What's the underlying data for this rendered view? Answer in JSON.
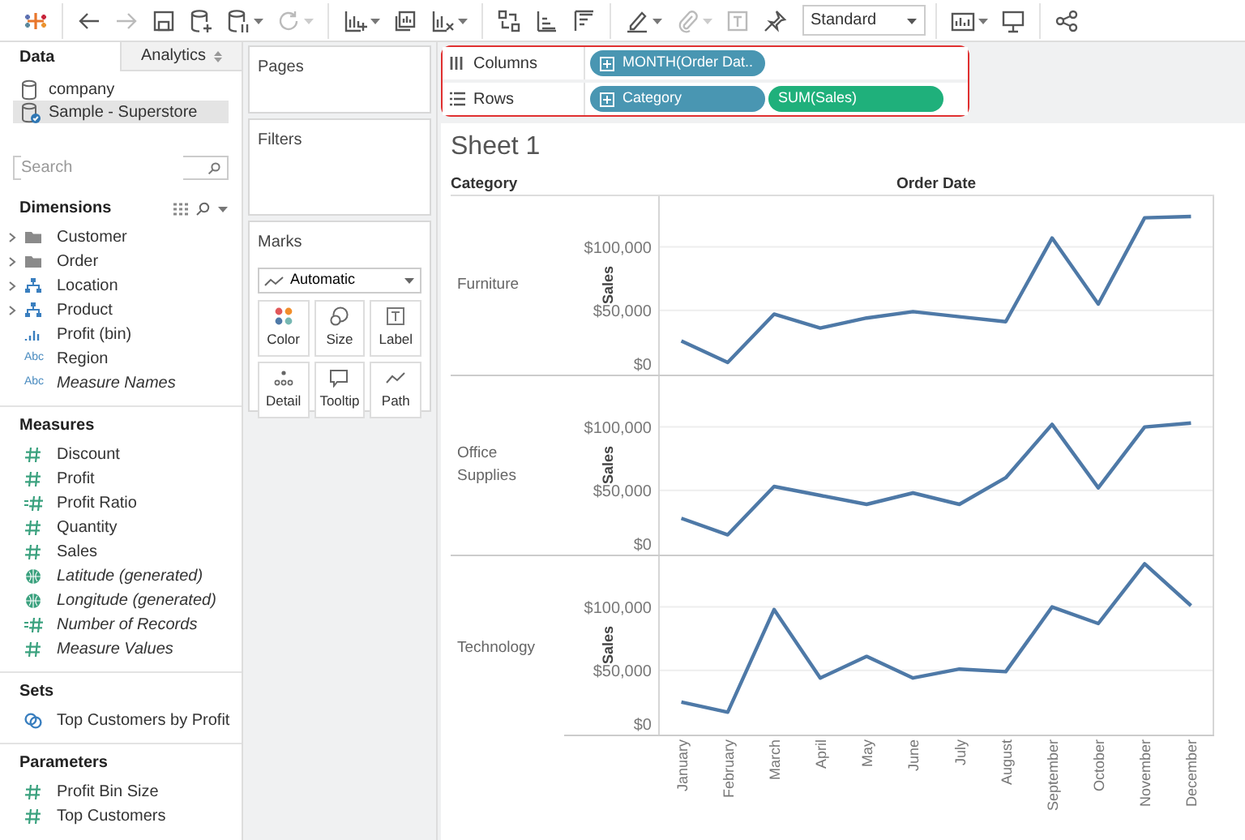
{
  "toolbar": {
    "groups": [
      [
        {
          "kind": "logo"
        }
      ],
      [
        {
          "kind": "back",
          "disabled": false,
          "menu": false
        },
        {
          "kind": "forward",
          "disabled": true,
          "menu": false
        },
        {
          "kind": "save",
          "disabled": false,
          "menu": false
        },
        {
          "kind": "new-datasource",
          "disabled": false,
          "menu": false
        },
        {
          "kind": "pause",
          "disabled": false,
          "menu": true
        },
        {
          "kind": "refresh",
          "disabled": true,
          "menu": true
        }
      ],
      [
        {
          "kind": "new-sheet",
          "disabled": false,
          "menu": true
        },
        {
          "kind": "duplicate",
          "disabled": false,
          "menu": false
        },
        {
          "kind": "clear",
          "disabled": false,
          "menu": true
        }
      ],
      [
        {
          "kind": "swap",
          "disabled": false,
          "menu": false
        },
        {
          "kind": "sort-asc",
          "disabled": false,
          "menu": false
        },
        {
          "kind": "sort-desc",
          "disabled": false,
          "menu": false
        }
      ],
      [
        {
          "kind": "highlight",
          "disabled": false,
          "menu": true
        },
        {
          "kind": "group",
          "disabled": true,
          "menu": true
        },
        {
          "kind": "label",
          "disabled": true,
          "menu": false
        },
        {
          "kind": "pin",
          "disabled": false,
          "menu": false
        },
        {
          "kind": "select",
          "value": "Standard",
          "disabled": false,
          "menu": true
        }
      ],
      [
        {
          "kind": "show-me",
          "disabled": false,
          "menu": true
        },
        {
          "kind": "presentation",
          "disabled": false,
          "menu": false
        }
      ],
      [
        {
          "kind": "share",
          "disabled": false,
          "menu": false
        }
      ]
    ]
  },
  "data_pane": {
    "tabs": [
      {
        "label": "Data",
        "selected": true
      },
      {
        "label": "Analytics",
        "selected": false
      }
    ],
    "sources": [
      {
        "name": "company",
        "selected": false
      },
      {
        "name": "Sample - Superstore",
        "selected": true
      }
    ],
    "search": {
      "placeholder": "Search"
    },
    "sections": [
      {
        "title": "Dimensions",
        "has_tools": true,
        "fields": [
          {
            "name": "Customer",
            "kind": "folder",
            "italic": false
          },
          {
            "name": "Order",
            "kind": "folder",
            "italic": false
          },
          {
            "name": "Location",
            "kind": "hierarchy",
            "italic": false
          },
          {
            "name": "Product",
            "kind": "hierarchy",
            "italic": false
          },
          {
            "name": "Profit (bin)",
            "kind": "bin",
            "italic": false
          },
          {
            "name": "Region",
            "kind": "string",
            "icon_text": "Abc",
            "italic": false
          },
          {
            "name": "Measure Names",
            "kind": "string",
            "icon_text": "Abc",
            "italic": true
          }
        ]
      },
      {
        "title": "Measures",
        "has_tools": false,
        "fields": [
          {
            "name": "Discount",
            "kind": "number",
            "italic": false
          },
          {
            "name": "Profit",
            "kind": "number",
            "italic": false
          },
          {
            "name": "Profit Ratio",
            "kind": "calc",
            "italic": false
          },
          {
            "name": "Quantity",
            "kind": "number",
            "italic": false
          },
          {
            "name": "Sales",
            "kind": "number",
            "italic": false
          },
          {
            "name": "Latitude (generated)",
            "kind": "geo",
            "italic": true
          },
          {
            "name": "Longitude (generated)",
            "kind": "geo",
            "italic": true
          },
          {
            "name": "Number of Records",
            "kind": "calc",
            "italic": true
          },
          {
            "name": "Measure Values",
            "kind": "number",
            "italic": true
          }
        ]
      },
      {
        "title": "Sets",
        "has_tools": false,
        "fields": [
          {
            "name": "Top Customers by Profit",
            "kind": "set",
            "italic": false
          }
        ]
      },
      {
        "title": "Parameters",
        "has_tools": false,
        "fields": [
          {
            "name": "Profit Bin Size",
            "kind": "number",
            "italic": false
          },
          {
            "name": "Top Customers",
            "kind": "number",
            "italic": false
          }
        ]
      }
    ]
  },
  "cards": {
    "pages": {
      "title": "Pages"
    },
    "filters": {
      "title": "Filters"
    },
    "marks": {
      "title": "Marks",
      "mark_type": "Automatic",
      "buttons": [
        {
          "kind": "color",
          "label": "Color"
        },
        {
          "kind": "size",
          "label": "Size"
        },
        {
          "kind": "label",
          "label": "Label"
        },
        {
          "kind": "detail",
          "label": "Detail"
        },
        {
          "kind": "tooltip",
          "label": "Tooltip"
        },
        {
          "kind": "path",
          "label": "Path"
        }
      ]
    }
  },
  "shelves": [
    {
      "kind": "columns",
      "label": "Columns",
      "pills": [
        {
          "text": "MONTH(Order Dat..",
          "kind": "discrete"
        }
      ]
    },
    {
      "kind": "rows",
      "label": "Rows",
      "pills": [
        {
          "text": "Category",
          "kind": "discrete"
        },
        {
          "text": "SUM(Sales)",
          "kind": "continuous"
        }
      ]
    }
  ],
  "sheet": {
    "title": "Sheet 1",
    "row_header": "Category",
    "column_header": "Order Date",
    "panes": [
      {
        "label": "Furniture",
        "chart_data": {
          "type": "line",
          "ylabel": "Sales",
          "ylim": [
            0,
            140000
          ],
          "yticks": [
            {
              "value": 0,
              "label": "$0"
            },
            {
              "value": 50000,
              "label": "$50,000"
            },
            {
              "value": 100000,
              "label": "$100,000"
            }
          ],
          "series": [
            {
              "color": "#4e79a7",
              "values": [
                26000,
                9000,
                47000,
                36000,
                44000,
                49000,
                45000,
                41000,
                107000,
                55000,
                123000,
                124000
              ]
            }
          ]
        }
      },
      {
        "label": "Office Supplies",
        "chart_data": {
          "type": "line",
          "ylabel": "Sales",
          "ylim": [
            0,
            140000
          ],
          "yticks": [
            {
              "value": 0,
              "label": "$0"
            },
            {
              "value": 50000,
              "label": "$50,000"
            },
            {
              "value": 100000,
              "label": "$100,000"
            }
          ],
          "series": [
            {
              "color": "#4e79a7",
              "values": [
                28000,
                15000,
                53000,
                46000,
                39000,
                48000,
                39000,
                60000,
                102000,
                52000,
                100000,
                103000
              ]
            }
          ]
        }
      },
      {
        "label": "Technology",
        "chart_data": {
          "type": "line",
          "ylabel": "Sales",
          "ylim": [
            0,
            140000
          ],
          "yticks": [
            {
              "value": 0,
              "label": "$0"
            },
            {
              "value": 50000,
              "label": "$50,000"
            },
            {
              "value": 100000,
              "label": "$100,000"
            }
          ],
          "categories": [
            "January",
            "February",
            "March",
            "April",
            "May",
            "June",
            "July",
            "August",
            "September",
            "October",
            "November",
            "December"
          ],
          "series": [
            {
              "color": "#4e79a7",
              "values": [
                25000,
                17000,
                98000,
                44000,
                61000,
                44000,
                51000,
                49000,
                100000,
                87000,
                134000,
                101000
              ]
            }
          ]
        }
      }
    ]
  }
}
